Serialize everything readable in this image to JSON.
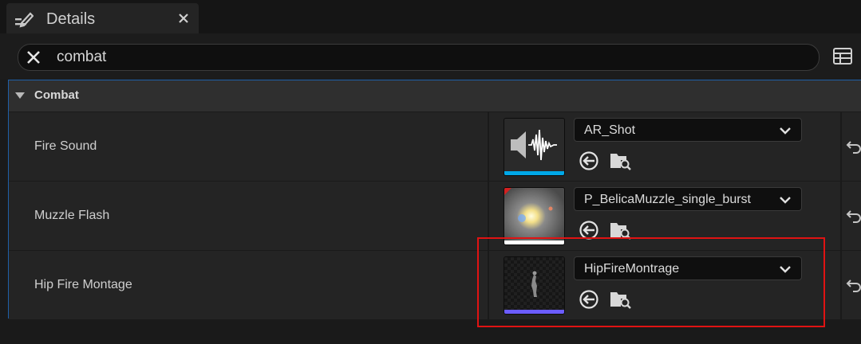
{
  "tab": {
    "title": "Details",
    "icon": "details-pencil-icon",
    "close_icon": "close-icon"
  },
  "search": {
    "value": "combat",
    "placeholder": "Search"
  },
  "category": {
    "label": "Combat",
    "expanded": true
  },
  "rows": [
    {
      "label": "Fire Sound",
      "asset": "AR_Shot",
      "thumbnail_icon": "sound-wave-icon",
      "asset_color": "#00a8e8"
    },
    {
      "label": "Muzzle Flash",
      "asset": "P_BelicaMuzzle_single_burst",
      "thumbnail_icon": "particle-system-icon",
      "asset_color": "#ffffff"
    },
    {
      "label": "Hip Fire Montage",
      "asset": "HipFireMontrage",
      "thumbnail_icon": "anim-montage-icon",
      "asset_color": "#6b5cff"
    }
  ],
  "colors": {
    "accent_border": "#1f5fa8",
    "highlight": "#e01313"
  }
}
